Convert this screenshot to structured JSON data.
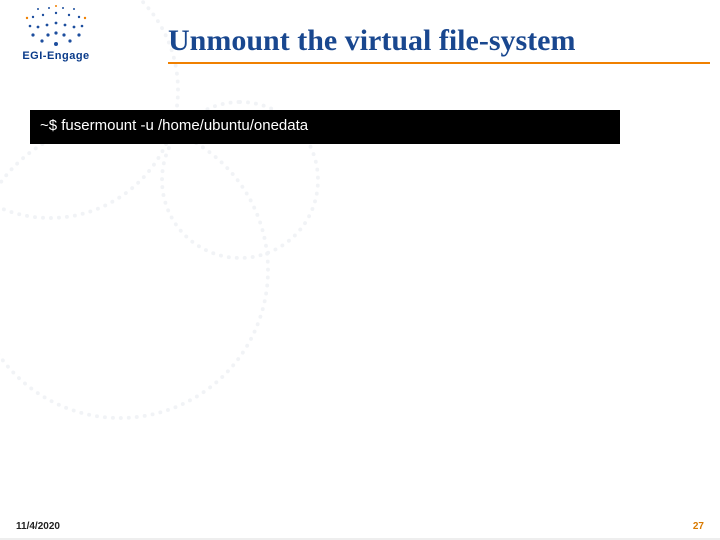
{
  "logo": {
    "brand_top": "EGI",
    "brand_bottom": "EGI-Engage"
  },
  "slide": {
    "title": "Unmount the virtual file-system",
    "terminal_line": "~$ fusermount -u /home/ubuntu/onedata"
  },
  "footer": {
    "date": "11/4/2020",
    "page": "27"
  },
  "colors": {
    "title": "#19478f",
    "accent": "#f08000",
    "page_number": "#d97a00"
  }
}
